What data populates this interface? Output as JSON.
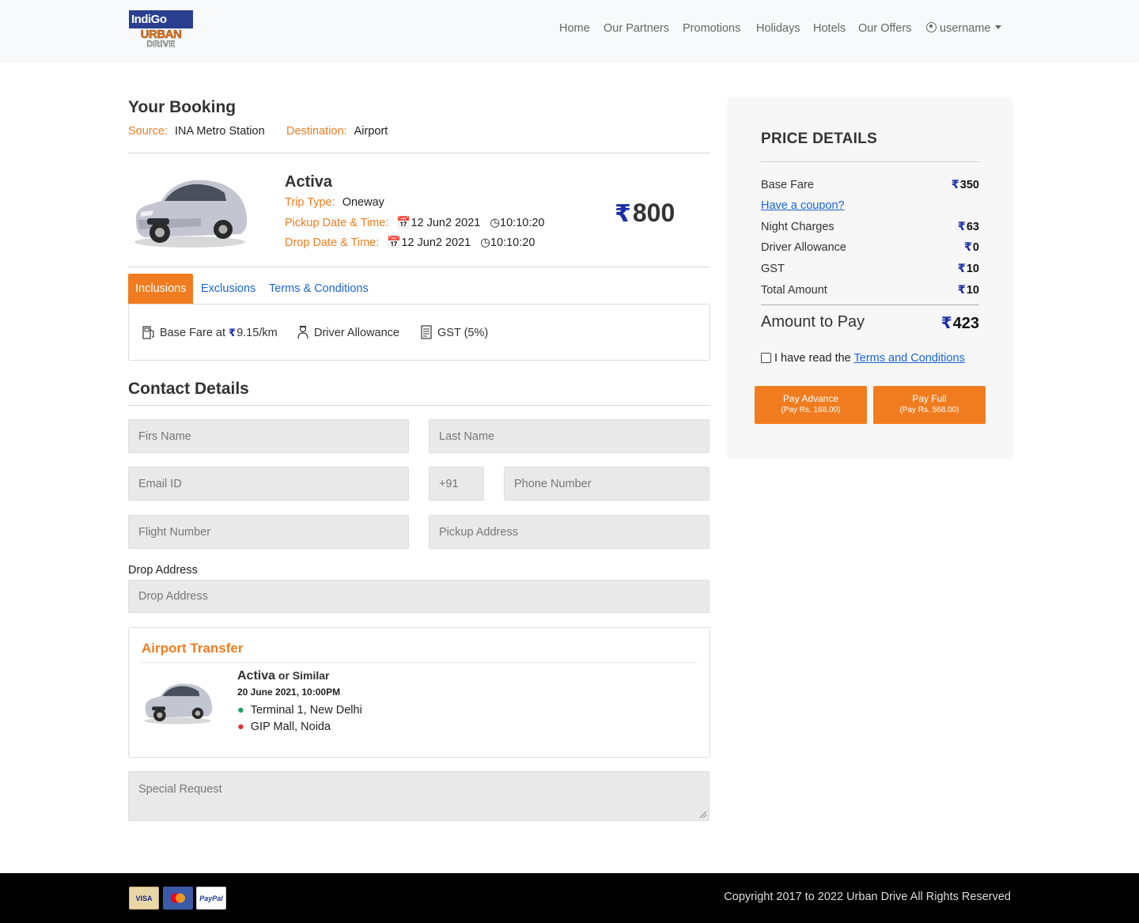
{
  "brand": {
    "top": "IndiGo",
    "urban": "URBAN",
    "drive": "DRIVE"
  },
  "nav": {
    "items": [
      "Home",
      "Our Partners",
      "Promotions",
      "Holidays",
      "Hotels",
      "Our Offers"
    ],
    "user": "username"
  },
  "booking": {
    "heading": "Your Booking",
    "source_label": "Source:",
    "source_value": "INA Metro Station",
    "destination_label": "Destination:",
    "destination_value": "Airport",
    "car_name": "Activa",
    "trip_type_label": "Trip Type:",
    "trip_type_value": "Oneway",
    "pickup_label": "Pickup Date & Time:",
    "pickup_date": "12 Jun2 2021",
    "pickup_time": "10:10:20",
    "drop_label": "Drop Date & Time:",
    "drop_date": "12 Jun2 2021",
    "drop_time": "10:10:20",
    "price": "800",
    "currency_symbol": "₹"
  },
  "tabs": [
    "Inclusions",
    "Exclusions",
    "Terms & Conditions"
  ],
  "inclusions": {
    "base_fare_prefix": "Base Fare at",
    "base_fare_value": "9.15/km",
    "driver_allowance": "Driver Allowance",
    "gst": "GST (5%)"
  },
  "contact": {
    "heading": "Contact Details",
    "first_name_placeholder": "Firs Name",
    "last_name_placeholder": "Last Name",
    "email_placeholder": "Email ID",
    "country_code": "+91",
    "phone_placeholder": "Phone Number",
    "flight_placeholder": "Flight Number",
    "pickup_address_placeholder": "Pickup Address",
    "drop_address_label": "Drop Address",
    "drop_address_placeholder": "Drop Address",
    "special_request_placeholder": "Special Request"
  },
  "transfer": {
    "title": "Airport Transfer",
    "car_name": "Activa",
    "similar": "or Similar",
    "datetime": "20 June 2021, 10:00PM",
    "from": "Terminal 1, New Delhi",
    "to": "GIP Mall, Noida"
  },
  "price_details": {
    "heading": "PRICE DETAILS",
    "base_fare_label": "Base Fare",
    "base_fare_value": "350",
    "coupon_link": "Have a coupon?",
    "night_label": "Night Charges",
    "night_value": "63",
    "driver_label": "Driver Allowance",
    "driver_value": "0",
    "gst_label": "GST",
    "gst_value": "10",
    "total_label": "Total Amount",
    "total_value": "10",
    "pay_label": "Amount to Pay",
    "pay_value": "423",
    "terms_prefix": "I have read the",
    "terms_link": "Terms and Conditions",
    "pay_advance": "Pay Advance",
    "pay_advance_sub": "(Pay Rs. 168.00)",
    "pay_full": "Pay Full",
    "pay_full_sub": "(Pay Rs. 568.00)"
  },
  "footer": {
    "cards": [
      "VISA",
      "PayPal"
    ],
    "copyright": "Copyright 2017 to 2022 Urban Drive All Rights Reserved"
  },
  "colors": {
    "accent": "#f07c1f",
    "link": "#1a64d4",
    "rupee": "#1a2fa8",
    "footer": "#000000"
  }
}
